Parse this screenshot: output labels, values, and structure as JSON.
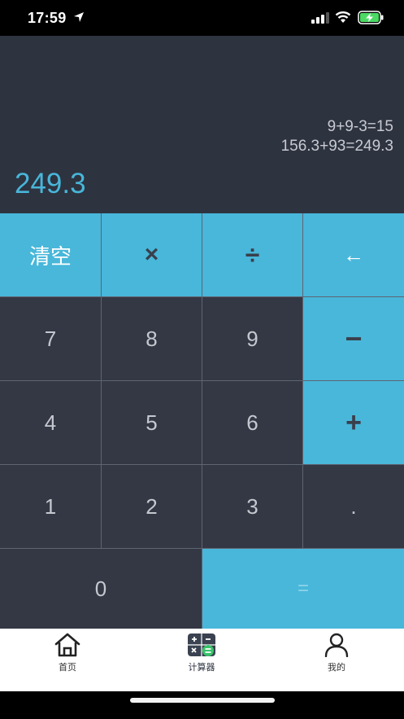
{
  "status": {
    "time": "17:59"
  },
  "display": {
    "history": [
      "9+9-3=15",
      "156.3+93=249.3"
    ],
    "result": "249.3"
  },
  "keypad": {
    "clear": "清空",
    "multiply": "×",
    "divide": "÷",
    "backspace": "←",
    "minus": "−",
    "plus": "+",
    "dot": ".",
    "equals": "=",
    "digits": {
      "d0": "0",
      "d1": "1",
      "d2": "2",
      "d3": "3",
      "d4": "4",
      "d5": "5",
      "d6": "6",
      "d7": "7",
      "d8": "8",
      "d9": "9"
    }
  },
  "tabs": [
    {
      "label": "首页",
      "icon": "home-icon"
    },
    {
      "label": "计算器",
      "icon": "calculator-icon"
    },
    {
      "label": "我的",
      "icon": "user-icon"
    }
  ],
  "colors": {
    "accent": "#48b7da",
    "key_dark": "#343845",
    "display_bg": "#2e3340"
  }
}
